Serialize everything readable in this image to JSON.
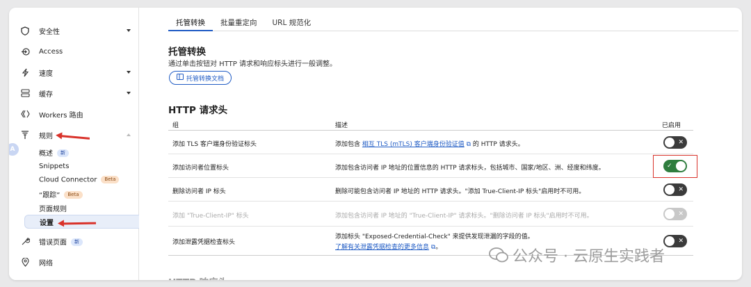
{
  "sidebar": {
    "items": [
      {
        "label": "安全性",
        "icon": "shield-icon",
        "caret": "down"
      },
      {
        "label": "Access",
        "icon": "access-icon",
        "caret": ""
      },
      {
        "label": "速度",
        "icon": "lightning-icon",
        "caret": "down"
      },
      {
        "label": "缓存",
        "icon": "cache-icon",
        "caret": "down"
      },
      {
        "label": "Workers 路由",
        "icon": "workers-icon",
        "caret": ""
      },
      {
        "label": "规则",
        "icon": "rules-icon",
        "caret": "up"
      }
    ],
    "rules_sub": [
      {
        "label": "概述",
        "badge": "新"
      },
      {
        "label": "Snippets",
        "badge": ""
      },
      {
        "label": "Cloud Connector",
        "badge": "Beta"
      },
      {
        "label": "“跟踪”",
        "badge": "Beta"
      },
      {
        "label": "页面规则",
        "badge": ""
      },
      {
        "label": "设置",
        "badge": ""
      }
    ],
    "bottom_items": [
      {
        "label": "错误页面",
        "badge": "新",
        "icon": "wrench-icon"
      },
      {
        "label": "网络",
        "icon": "location-pin-icon"
      }
    ],
    "avatar_letter": "A"
  },
  "tabs": [
    "托管转换",
    "批量重定向",
    "URL 规范化"
  ],
  "managed": {
    "title": "托管转换",
    "description": "通过单击按钮对 HTTP 请求和响应标头进行一般调整。",
    "doc_button": "托管转换文档"
  },
  "http_request_headers": {
    "title": "HTTP 请求头",
    "columns": [
      "组",
      "描述",
      "已启用"
    ],
    "rows": [
      {
        "group": "添加 TLS 客户端身份验证标头",
        "desc_prefix": "添加包含 ",
        "desc_link": "相互 TLS (mTLS) 客户端身份验证值",
        "desc_suffix": " 的 HTTP 请求头。",
        "enabled": false,
        "disabled": false
      },
      {
        "group": "添加访问者位置标头",
        "desc": "添加包含访问者 IP 地址的位置信息的 HTTP 请求标头，包括城市、国家/地区、洲、经度和纬度。",
        "enabled": true,
        "disabled": false
      },
      {
        "group": "删除访问者 IP 标头",
        "desc": "删除可能包含访问者 IP 地址的 HTTP 请求头。\"添加 True-Client-IP 标头\"启用时不可用。",
        "enabled": false,
        "disabled": false
      },
      {
        "group": "添加 \"True-Client-IP\" 标头",
        "desc": "添加包含访问者 IP 地址的 \"True-Client-IP\" 请求标头。\"删除访问者 IP 标头\"启用时不可用。",
        "enabled": false,
        "disabled": true
      },
      {
        "group": "添加泄露凭据检查标头",
        "desc": "添加标头 \"Exposed-Credential-Check\" 来提供发现泄漏的字段的值。",
        "desc_link2": "了解有关泄露凭据检查的更多信息",
        "enabled": false,
        "disabled": false
      }
    ]
  },
  "next_section_partial": "HTTP 响应头",
  "watermark": "公众号 · 云原生实践者",
  "colors": {
    "accent": "#1f5bc4",
    "toggle_on": "#2f7d3e",
    "toggle_off": "#3b3b3b",
    "annotation_red": "#d9322a"
  }
}
